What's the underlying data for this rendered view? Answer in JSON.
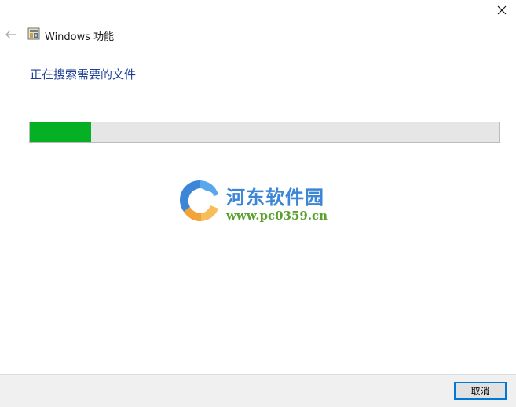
{
  "window": {
    "title": "Windows 功能"
  },
  "icons": {
    "close": "close-icon",
    "back": "back-arrow-icon",
    "app": "windows-features-icon"
  },
  "status": {
    "heading": "正在搜索需要的文件",
    "progress": 0.13
  },
  "watermark": {
    "title": "河东软件园",
    "url": "www.pc0359.cn"
  },
  "footer": {
    "cancel_label": "取消"
  },
  "colors": {
    "heading": "#1e3f93",
    "progress_fill": "#06b025",
    "progress_track": "#e6e6e6",
    "footer_bg": "#f0f0f0",
    "button_focus_border": "#0078d7"
  }
}
